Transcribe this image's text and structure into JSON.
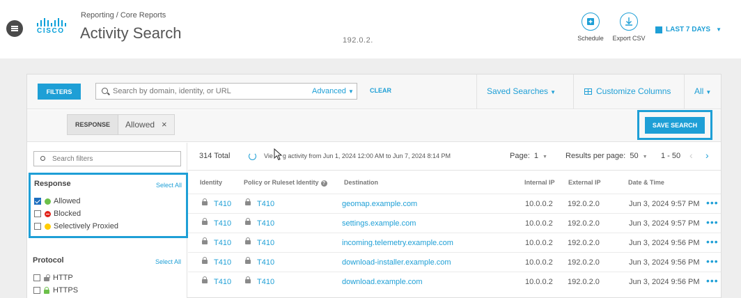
{
  "header": {
    "breadcrumb": "Reporting / Core Reports",
    "title": "Activity Search",
    "center_ip": "192.0.2.",
    "logo_text": "CISCO",
    "schedule_label": "Schedule",
    "export_label": "Export CSV",
    "date_range": "LAST 7 DAYS"
  },
  "toolbar": {
    "filters_label": "FILTERS",
    "search_placeholder": "Search by domain, identity, or URL",
    "advanced_label": "Advanced",
    "clear_label": "CLEAR",
    "saved_searches_label": "Saved Searches",
    "customize_columns_label": "Customize Columns",
    "all_label": "All"
  },
  "active_filter": {
    "key": "RESPONSE",
    "value": "Allowed",
    "remove": "×"
  },
  "save_search_label": "SAVE SEARCH",
  "filters": {
    "search_placeholder": "Search filters",
    "response": {
      "title": "Response",
      "select_all": "Select All",
      "options": [
        {
          "label": "Allowed",
          "checked": true,
          "color": "#6cc04a"
        },
        {
          "label": "Blocked",
          "checked": false,
          "color": "#e2231a"
        },
        {
          "label": "Selectively Proxied",
          "checked": false,
          "color": "#ffcc00"
        }
      ]
    },
    "protocol": {
      "title": "Protocol",
      "select_all": "Select All",
      "options": [
        {
          "label": "HTTP",
          "checked": false
        },
        {
          "label": "HTTPS",
          "checked": false
        }
      ]
    }
  },
  "results": {
    "total": "314 Total",
    "viewing_a": "Vie",
    "viewing_b": "g activity from Jun 1, 2024 12:00 AM to Jun 7, 2024 8:14 PM",
    "page_label": "Page:",
    "page_value": "1",
    "rpp_label": "Results per page:",
    "rpp_value": "50",
    "range": "1 - 50",
    "prev": "‹",
    "next": "›"
  },
  "table": {
    "columns": [
      "Identity",
      "Policy or Ruleset Identity",
      "Destination",
      "Internal IP",
      "External IP",
      "Date & Time"
    ],
    "help_glyph": "?",
    "more_glyph": "•••",
    "rows": [
      {
        "identity": "T410",
        "policy": "T410",
        "destination": "geomap.example.com",
        "internal_ip": "10.0.0.2",
        "external_ip": "192.0.2.0",
        "datetime": "Jun 3, 2024 9:57 PM"
      },
      {
        "identity": "T410",
        "policy": "T410",
        "destination": "settings.example.com",
        "internal_ip": "10.0.0.2",
        "external_ip": "192.0.2.0",
        "datetime": "Jun 3, 2024 9:57 PM"
      },
      {
        "identity": "T410",
        "policy": "T410",
        "destination": "incoming.telemetry.example.com",
        "internal_ip": "10.0.0.2",
        "external_ip": "192.0.2.0",
        "datetime": "Jun 3, 2024 9:56 PM"
      },
      {
        "identity": "T410",
        "policy": "T410",
        "destination": "download-installer.example.com",
        "internal_ip": "10.0.0.2",
        "external_ip": "192.0.2.0",
        "datetime": "Jun 3, 2024 9:56 PM"
      },
      {
        "identity": "T410",
        "policy": "T410",
        "destination": "download.example.com",
        "internal_ip": "10.0.0.2",
        "external_ip": "192.0.2.0",
        "datetime": "Jun 3, 2024 9:56 PM"
      }
    ]
  },
  "colors": {
    "accent": "#1e9fd6",
    "allowed": "#6cc04a",
    "blocked": "#e2231a",
    "proxied": "#ffcc00"
  }
}
